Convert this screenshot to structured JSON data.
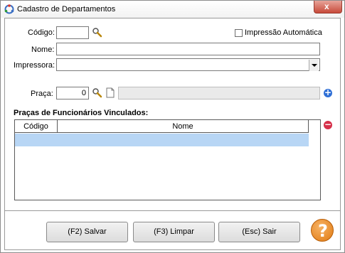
{
  "window": {
    "title": "Cadastro de Departamentos",
    "close_symbol": "x"
  },
  "form": {
    "codigo_label": "Código:",
    "codigo_value": "",
    "impressao_label": "Impressão Automática",
    "impressao_checked": false,
    "nome_label": "Nome:",
    "nome_value": "",
    "impressora_label": "Impressora:",
    "impressora_value": "",
    "praca_label": "Praça:",
    "praca_value": "0",
    "praca_nome_value": ""
  },
  "linked": {
    "title": "Praças de Funcionários Vinculados:",
    "columns": [
      "Código",
      "Nome"
    ],
    "rows": [
      {
        "codigo": "",
        "nome": ""
      }
    ]
  },
  "buttons": {
    "save": "(F2) Salvar",
    "clear": "(F3) Limpar",
    "exit": "(Esc) Sair",
    "help": "?"
  },
  "icons": {
    "add": "+",
    "remove": "−"
  },
  "colors": {
    "add": "#2f6fd6",
    "remove": "#d6304a",
    "help": "#e8881c",
    "selected_row": "#b8d6f5"
  }
}
